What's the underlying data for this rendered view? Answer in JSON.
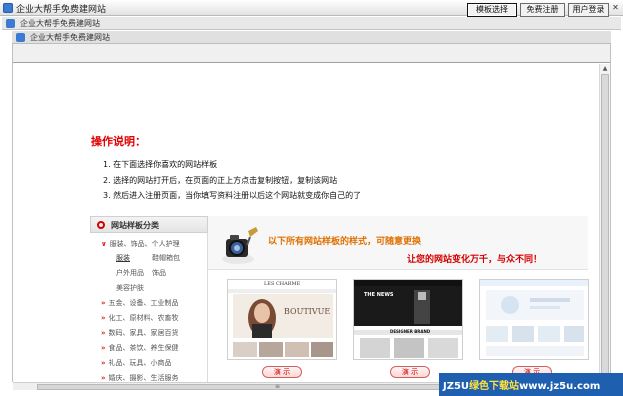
{
  "app": {
    "title": "企业大帮手免费建网站"
  },
  "inner1": {
    "title": "企业大帮手免费建网站"
  },
  "inner2": {
    "title": "企业大帮手免费建网站"
  },
  "toolbar": {
    "buttons": [
      "模板选择",
      "免费注册",
      "用户登录"
    ]
  },
  "instructions": {
    "title": "操作说明：",
    "lines": [
      "1. 在下面选择你喜欢的网站样板",
      "2. 选择的网站打开后，在页面的正上方点击复制按钮，复制该网站",
      "3. 然后进入注册页面，当你填写资料注册以后这个网站就变成你自己的了"
    ]
  },
  "categories": {
    "header": "网站样板分类",
    "groups": [
      {
        "label": "服装、饰品、个人护理",
        "expanded": true,
        "subs": [
          [
            "服装",
            "鞋帽箱包"
          ],
          [
            "户外用品",
            "饰品"
          ],
          [
            "美容护肤"
          ]
        ]
      },
      {
        "label": "五金、设备、工业制品"
      },
      {
        "label": "化工、原材料、农畜牧"
      },
      {
        "label": "数码、家具、家居百货"
      },
      {
        "label": "食品、茶饮、养生保健"
      },
      {
        "label": "礼品、玩具、小商品"
      },
      {
        "label": "婚庆、摄影、生活服务"
      }
    ],
    "selected_sub": "服装"
  },
  "banner": {
    "line1": "以下所有网站样板的样式，可随意更换",
    "line2": "让您的网站变化万千，与众不同！"
  },
  "templates": [
    {
      "demo_label": "演 示",
      "brand": "LES CHARME",
      "headline": "BOUTIVUE"
    },
    {
      "demo_label": "演 示",
      "brand": "THE NEWS",
      "headline": "DESIGNER BRAND"
    },
    {
      "demo_label": "演 示"
    }
  ],
  "watermark": {
    "prefix": "JZ5U",
    "mid": "绿色下载站",
    "suffix": "www.jz5u.com"
  },
  "colors": {
    "accent_red": "#e20000",
    "banner_orange": "#e07000",
    "selection_blue": "#1f5fb0"
  }
}
